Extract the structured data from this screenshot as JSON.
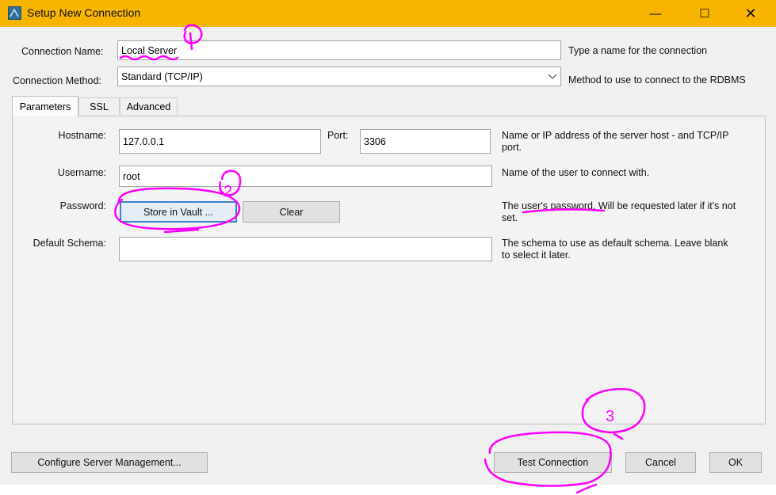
{
  "window": {
    "title": "Setup New Connection",
    "minimize": "—",
    "maximize": "☐",
    "close": "✕"
  },
  "connection_name": {
    "label": "Connection Name:",
    "value": "Local Server",
    "help": "Type a name for the connection"
  },
  "connection_method": {
    "label": "Connection Method:",
    "value": "Standard (TCP/IP)",
    "help": "Method to use to connect to the RDBMS"
  },
  "tabs": [
    {
      "label": "Parameters",
      "selected": true
    },
    {
      "label": "SSL",
      "selected": false
    },
    {
      "label": "Advanced",
      "selected": false
    }
  ],
  "parameters": {
    "hostname": {
      "label": "Hostname:",
      "value": "127.0.0.1"
    },
    "port": {
      "label": "Port:",
      "value": "3306"
    },
    "host_help": "Name or IP address of the server host - and TCP/IP port.",
    "username": {
      "label": "Username:",
      "value": "root",
      "help": "Name of the user to connect with."
    },
    "password": {
      "label": "Password:",
      "store_button": "Store in Vault ...",
      "clear_button": "Clear",
      "help": "The user's password. Will be requested later if it's not set."
    },
    "default_schema": {
      "label": "Default Schema:",
      "value": "",
      "help": "The schema to use as default schema. Leave blank to select it later."
    }
  },
  "footer": {
    "configure_button": "Configure Server Management...",
    "test_button": "Test Connection",
    "cancel_button": "Cancel",
    "ok_button": "OK"
  },
  "annotations": {
    "marks": [
      "①",
      "2",
      "3"
    ],
    "color": "#ff00ff"
  },
  "colors": {
    "titlebar": "#f7b500",
    "focus_border": "#3c83c9"
  }
}
